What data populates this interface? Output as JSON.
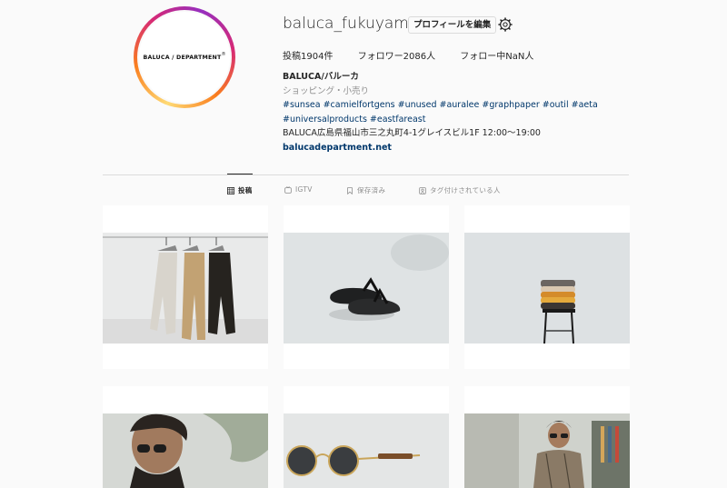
{
  "profile": {
    "avatar_text": "BALUCA / DEPARTMENT",
    "username": "baluca_fukuyama",
    "edit_label": "プロフィールを編集",
    "settings_icon": "gear-icon",
    "stats": {
      "posts": "投稿1904件",
      "followers": "フォロワー2086人",
      "following": "フォロー中NaN人"
    },
    "bio": {
      "name": "BALUCA/バルーカ",
      "category": "ショッピング・小売り",
      "tags_line1": "#sunsea #camielfortgens #unused #auralee #graphpaper #outil #aeta",
      "tags_line2": "#universalproducts #eastfareast",
      "address": "BALUCA広島県福山市三之丸町4-1グレイスビル1F 12:00〜19:00",
      "link": "balucadepartment.net"
    }
  },
  "tabs": [
    {
      "label": "投稿",
      "icon": "grid-icon",
      "active": true
    },
    {
      "label": "IGTV",
      "icon": "igtv-icon",
      "active": false
    },
    {
      "label": "保存済み",
      "icon": "bookmark-icon",
      "active": false
    },
    {
      "label": "タグ付けされている人",
      "icon": "tag-user-icon",
      "active": false
    }
  ],
  "posts": [
    {
      "subject": "pants-on-hangers"
    },
    {
      "subject": "black-sandals"
    },
    {
      "subject": "folded-beanies-on-stool"
    },
    {
      "subject": "man-with-sunglasses"
    },
    {
      "subject": "round-sunglasses"
    },
    {
      "subject": "man-in-shop"
    }
  ],
  "colors": {
    "link": "#00376b",
    "muted": "#8e8e8e",
    "border": "#dbdbdb",
    "background": "#fafafa"
  }
}
